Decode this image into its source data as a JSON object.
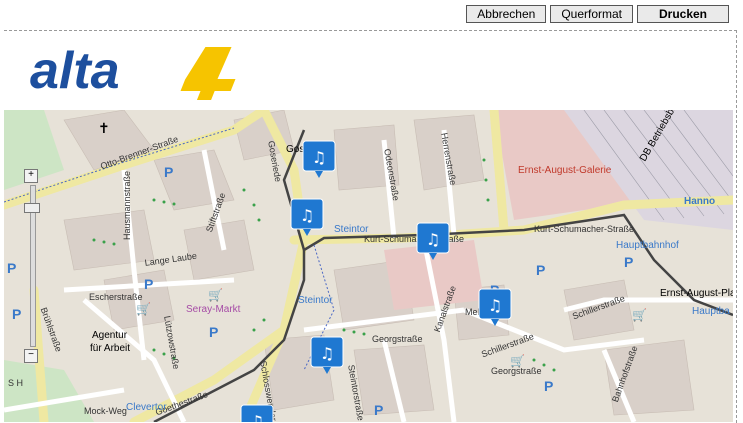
{
  "toolbar": {
    "cancel_label": "Abbrechen",
    "landscape_label": "Querformat",
    "print_label": "Drucken"
  },
  "logo": {
    "text": "alta4"
  },
  "map": {
    "streets": {
      "otto_brenner": "Otto-Brenner-Straße",
      "goseriede": "Goseriede",
      "odeonstrasse": "Odeonstraße",
      "herrenstrasse": "Herrenstraße",
      "hausmannstrasse": "Hausmannstraße",
      "stiftstrasse": "Stiftstraße",
      "lange_laube": "Lange Laube",
      "escherstrasse": "Escherstraße",
      "brueckstrasse": "Brühlstraße",
      "kurt_schumacher_1": "Kurt-Schumacher-Straße",
      "kurt_schumacher_2": "Kurt-Schumacher-Straße",
      "kanalstrasse": "Kanalstraße",
      "georgstrasse_1": "Georgstraße",
      "georgstrasse_2": "Georgstraße",
      "schillerstrasse_1": "Schillerstraße",
      "schillerstrasse_2": "Schillerstraße",
      "goethestrasse": "Goethestraße",
      "luetzowstrasse": "Lützowstraße",
      "schlosswender": "Schlosswender",
      "steintorstrasse": "Steintorstraße",
      "mehl": "Mehl",
      "bahnhofstrasse": "Bahnhofstraße",
      "mock_weg": "Mock-Weg",
      "osch_h": "S H"
    },
    "pois": {
      "ernst_august_galerie": "Ernst-August-Galerie",
      "steintor_1": "Steintor",
      "steintor_2": "Steintor",
      "hauptbahnhof": "Hauptbahnhof",
      "ernst_august_platz": "Ernst-August-Platz",
      "hauptba": "Hauptba",
      "seray_markt": "Seray-Markt",
      "agentur": "Agentur",
      "fuer_arbeit": "für Arbeit",
      "gos": "Gos",
      "hannover": "Hanno",
      "clevertor": "Clevertor",
      "db": "DB Betriebsbahnhof"
    },
    "zoom": {
      "plus": "+",
      "minus": "−"
    }
  },
  "colors": {
    "marker": "#1f78d1",
    "road_yellow": "#f6f5a8",
    "tram": "#444444"
  }
}
